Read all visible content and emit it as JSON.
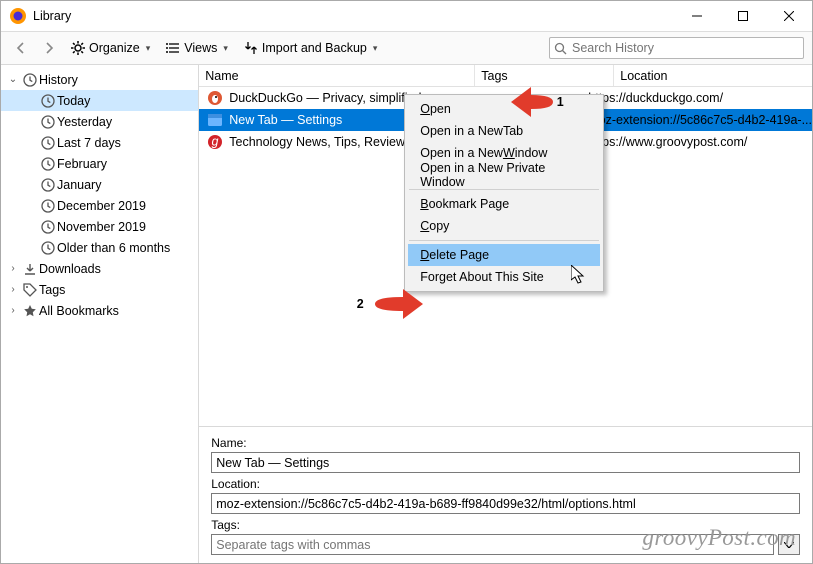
{
  "window": {
    "title": "Library"
  },
  "toolbar": {
    "organize": "Organize",
    "views": "Views",
    "import": "Import and Backup",
    "search_placeholder": "Search History"
  },
  "sidebar": {
    "items": [
      {
        "label": "History",
        "icon": "clock",
        "expanded": true,
        "level": 1,
        "selectable": true
      },
      {
        "label": "Today",
        "icon": "clock",
        "level": 2,
        "selected": true
      },
      {
        "label": "Yesterday",
        "icon": "clock",
        "level": 2
      },
      {
        "label": "Last 7 days",
        "icon": "clock",
        "level": 2
      },
      {
        "label": "February",
        "icon": "clock",
        "level": 2
      },
      {
        "label": "January",
        "icon": "clock",
        "level": 2
      },
      {
        "label": "December 2019",
        "icon": "clock",
        "level": 2
      },
      {
        "label": "November 2019",
        "icon": "clock",
        "level": 2
      },
      {
        "label": "Older than 6 months",
        "icon": "clock",
        "level": 2
      },
      {
        "label": "Downloads",
        "icon": "download",
        "level": 1,
        "expanded": false
      },
      {
        "label": "Tags",
        "icon": "tag",
        "level": 1,
        "expanded": false
      },
      {
        "label": "All Bookmarks",
        "icon": "star",
        "level": 1,
        "expanded": false
      }
    ]
  },
  "columns": {
    "name": "Name",
    "tags": "Tags",
    "location": "Location"
  },
  "rows": [
    {
      "icon": "ddg",
      "name": "DuckDuckGo — Privacy, simplified.",
      "tags": "",
      "location": "https://duckduckgo.com/",
      "selected": false
    },
    {
      "icon": "newtab",
      "name": "New Tab — Settings",
      "tags": "",
      "location": "moz-extension://5c86c7c5-d4b2-419a-...",
      "selected": true
    },
    {
      "icon": "gp",
      "name": "Technology News, Tips, Reviews",
      "tags": "",
      "location": "https://www.groovypost.com/",
      "selected": false
    }
  ],
  "context_menu": {
    "items": [
      {
        "label": "Open",
        "u": 0
      },
      {
        "label": "Open in a New Tab",
        "u": 13
      },
      {
        "label": "Open in a New Window",
        "u": 14
      },
      {
        "label": "Open in a New Private Window"
      },
      "sep",
      {
        "label": "Bookmark Page",
        "u": 0
      },
      {
        "label": "Copy",
        "u": 0
      },
      "sep",
      {
        "label": "Delete Page",
        "u": 0,
        "highlight": true
      },
      {
        "label": "Forget About This Site"
      }
    ]
  },
  "details": {
    "name_label": "Name:",
    "name_value": "New Tab — Settings",
    "location_label": "Location:",
    "location_value": "moz-extension://5c86c7c5-d4b2-419a-b689-ff9840d99e32/html/options.html",
    "tags_label": "Tags:",
    "tags_placeholder": "Separate tags with commas"
  },
  "annotations": {
    "a1": "1",
    "a2": "2"
  },
  "watermark": "groovyPost.com"
}
